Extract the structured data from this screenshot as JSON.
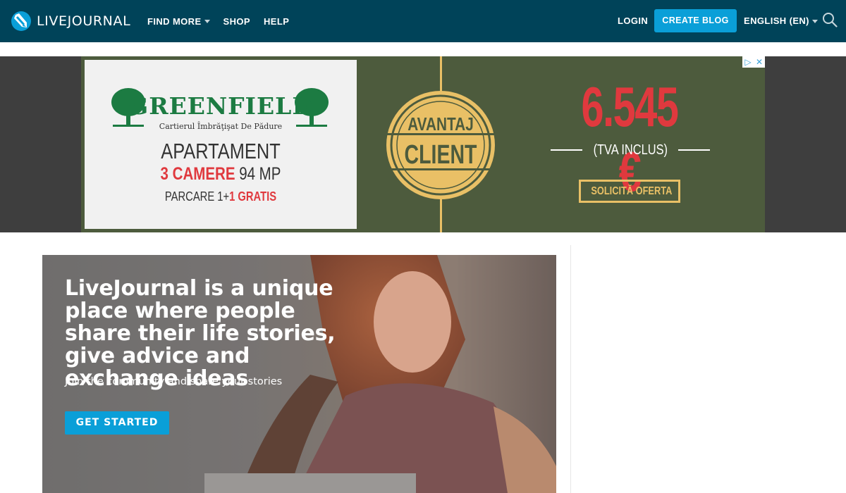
{
  "header": {
    "logo_text": "LIVEJOURNAL",
    "nav": [
      {
        "label": "FIND MORE",
        "has_dropdown": true
      },
      {
        "label": "SHOP",
        "has_dropdown": false
      },
      {
        "label": "HELP",
        "has_dropdown": false
      }
    ],
    "login_label": "LOGIN",
    "create_blog_label": "CREATE BLOG",
    "language_label": "ENGLISH (EN)",
    "search_icon": "search-icon",
    "colors": {
      "bar": "#004359",
      "accent": "#0a9fd8"
    }
  },
  "ad": {
    "brand": "GREENFIELD",
    "brand_tagline": "Cartierul Îmbrăţişat De Pădure",
    "headline": "APARTAMENT",
    "rooms_highlight": "3 CAMERE",
    "rooms_area": "94 MP",
    "parking_text": "PARCARE 1+",
    "parking_highlight": "1 GRATIS",
    "badge_top": "AVANTAJ",
    "badge_bottom": "CLIENT",
    "price": "6.545 €",
    "vat_note": "(TVA INCLUS)",
    "offer_label": "SOLICITĂ OFERTA",
    "adchoices_icon": "ad-choices-icon",
    "close_icon": "close-icon",
    "colors": {
      "red": "#e0393e",
      "gold": "#e9c066",
      "green": "#1c7b42",
      "panel": "#4d5b3d"
    }
  },
  "hero": {
    "title": "LiveJournal is a unique place where people share their life stories, give advice and exchange ideas",
    "subtitle": "Join the community and share your stories",
    "cta_label": "GET STARTED"
  }
}
